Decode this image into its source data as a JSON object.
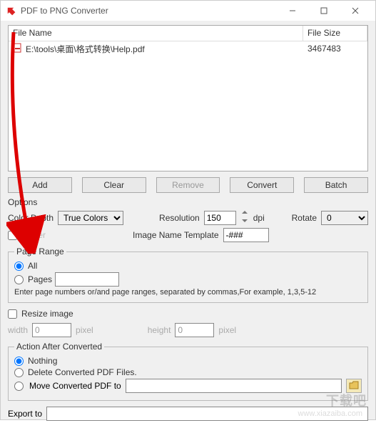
{
  "window": {
    "title": "PDF to PNG Converter"
  },
  "grid": {
    "headers": {
      "name": "File Name",
      "size": "File Size"
    },
    "rows": [
      {
        "name": "E:\\tools\\桌面\\格式转换\\Help.pdf",
        "size": "3467483"
      }
    ]
  },
  "buttons": {
    "add": "Add",
    "clear": "Clear",
    "remove": "Remove",
    "convert": "Convert",
    "batch": "Batch"
  },
  "options": {
    "section_label": "Options",
    "color_depth_label": "Color Depth",
    "color_depth_value": "True Colors",
    "resolution_label": "Resolution",
    "resolution_value": "150",
    "resolution_unit": "dpi",
    "rotate_label": "Rotate",
    "rotate_value": "0",
    "dither_label": "Dither",
    "template_label": "Image Name Template",
    "template_value": "-###"
  },
  "page_range": {
    "legend": "Page Range",
    "all": "All",
    "pages": "Pages",
    "pages_value": "",
    "hint": "Enter page numbers or/and page ranges, separated by commas,For example, 1,3,5-12"
  },
  "resize": {
    "label": "Resize image",
    "width_label": "width",
    "width_value": "0",
    "height_label": "height",
    "height_value": "0",
    "unit": "pixel"
  },
  "action": {
    "legend": "Action After Converted",
    "nothing": "Nothing",
    "delete": "Delete Converted PDF Files.",
    "move": "Move Converted PDF to",
    "move_value": ""
  },
  "export": {
    "label": "Export to",
    "value": ""
  },
  "watermark": {
    "main": "下载吧",
    "sub": "www.xiazaiba.com"
  }
}
